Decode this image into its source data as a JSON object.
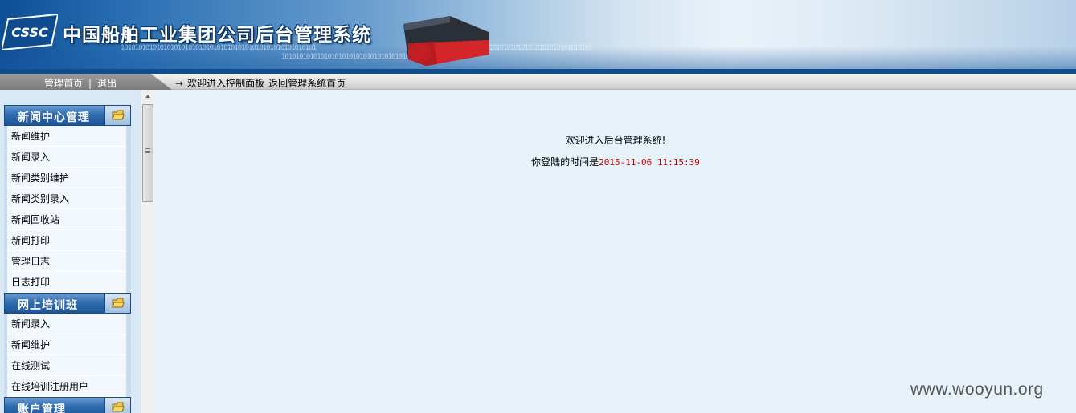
{
  "header": {
    "logo_text": "CSSC",
    "title": "中国船舶工业集团公司后台管理系统",
    "binary_lines": [
      "1010101010101010101010101010101010101010101010101010101",
      "101010101010101010101010101010101010101010101010101",
      "1010101010101010101010101010101010101010101010101"
    ]
  },
  "nav": {
    "home_label": "管理首页",
    "separator": "|",
    "logout_label": "退出",
    "arrow": "→",
    "welcome_text": "欢迎进入控制面板",
    "back_label": "返回管理系统首页"
  },
  "sidebar": {
    "groups": [
      {
        "title": "新闻中心管理",
        "items": [
          "新闻维护",
          "新闻录入",
          "新闻类别维护",
          "新闻类别录入",
          "新闻回收站",
          "新闻打印",
          "管理日志",
          "日志打印"
        ]
      },
      {
        "title": "网上培训班",
        "items": [
          "新闻录入",
          "新闻维护",
          "在线测试",
          "在线培训注册用户"
        ]
      },
      {
        "title": "账户管理",
        "items": []
      }
    ]
  },
  "main": {
    "welcome": "欢迎进入后台管理系统!",
    "login_prefix": "你登陆的时间是",
    "login_time": "2015-11-06 11:15:39"
  },
  "watermark": "www.wooyun.org",
  "colors": {
    "header_dark": "#0d4f95",
    "menu_head": "#2f6cb0",
    "page_bg": "#e6f1fa",
    "time_red": "#d00000"
  }
}
